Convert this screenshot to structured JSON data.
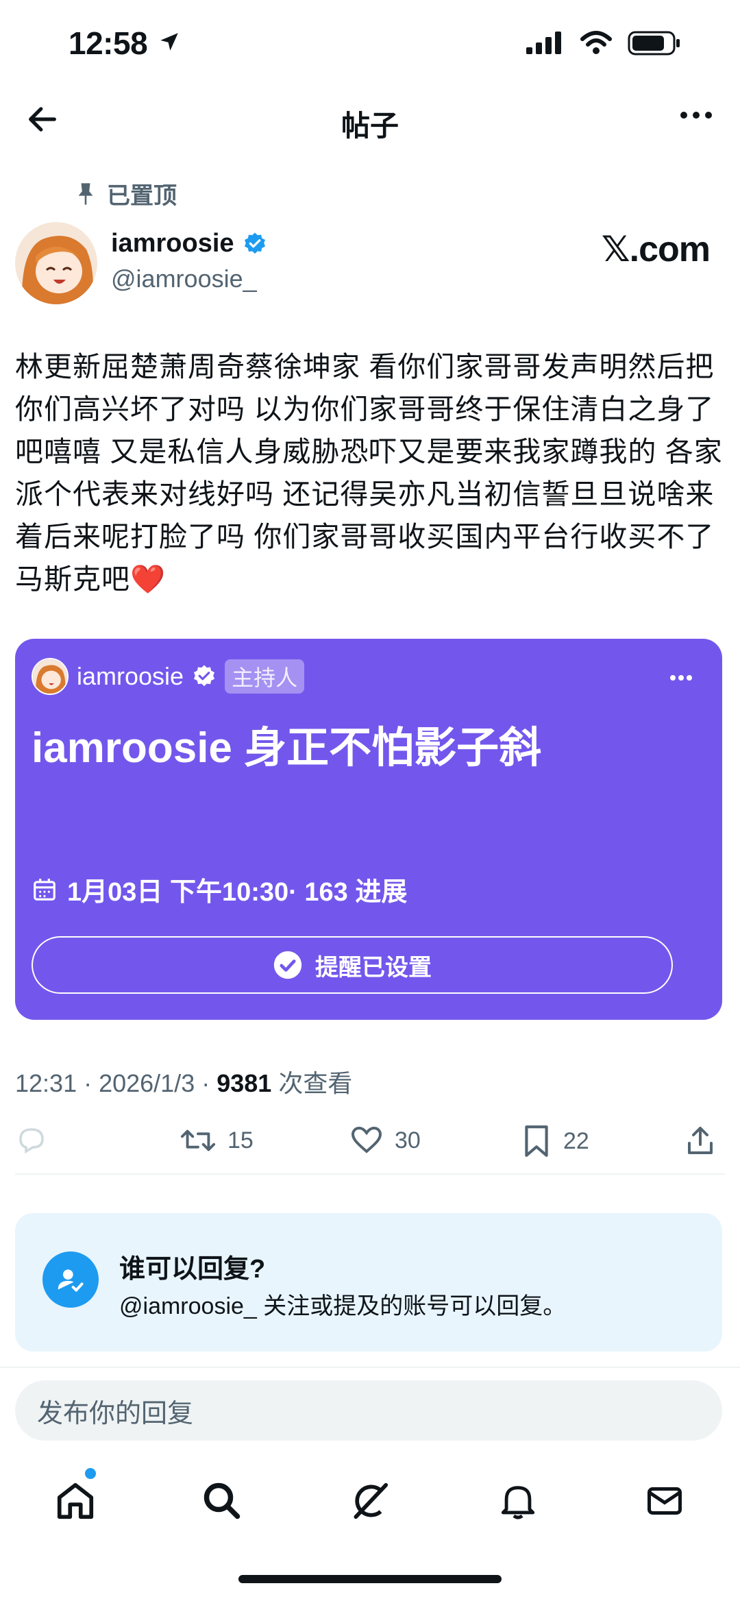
{
  "status_bar": {
    "time": "12:58"
  },
  "nav": {
    "title": "帖子"
  },
  "post": {
    "pinned_label": "已置顶",
    "author_name": "iamroosie",
    "author_handle": "@iamroosie_",
    "watermark": "𝕏.com",
    "text": "林更新屈楚萧周奇蔡徐坤家 看你们家哥哥发声明然后把你们高兴坏了对吗 以为你们家哥哥终于保住清白之身了吧嘻嘻 又是私信人身威胁恐吓又是要来我家蹲我的 各家派个代表来对线好吗 还记得吴亦凡当初信誓旦旦说啥来着后来呢打脸了吗 你们家哥哥收买国内平台行收买不了马斯克吧❤️",
    "time": "12:31",
    "date": "2026/1/3",
    "views": "9381",
    "views_label": "次查看"
  },
  "space_card": {
    "host_name": "iamroosie",
    "host_badge": "主持人",
    "title": "iamroosie 身正不怕影子斜",
    "schedule": "1月03日 下午10:30· 163 进展",
    "reminder_label": "提醒已设置",
    "color": "#7357ec"
  },
  "actions": {
    "retweets": "15",
    "likes": "30",
    "bookmarks": "22"
  },
  "reply_settings": {
    "title": "谁可以回复?",
    "desc": "@iamroosie_ 关注或提及的账号可以回复。"
  },
  "reply_input": {
    "placeholder": "发布你的回复"
  },
  "tabs": [
    "home-icon",
    "search-icon",
    "grok-icon",
    "notifications-icon",
    "messages-icon"
  ]
}
